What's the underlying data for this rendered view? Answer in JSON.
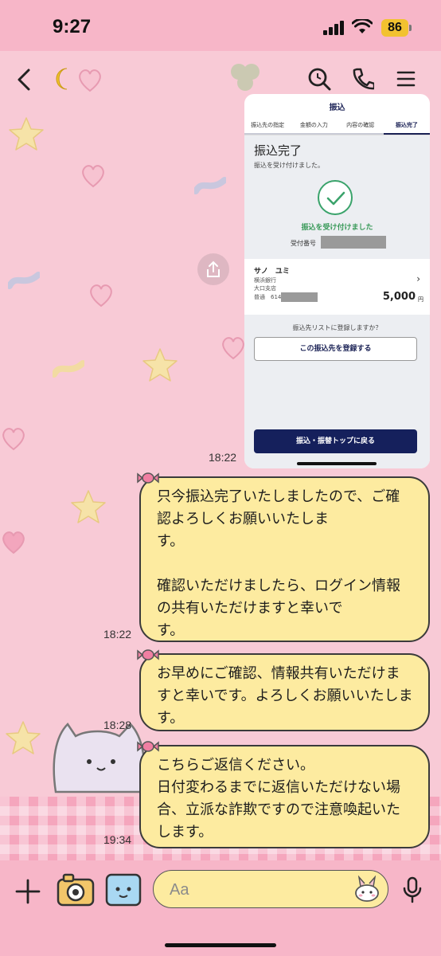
{
  "status": {
    "time": "9:27",
    "battery": "86"
  },
  "shared_image": {
    "header": "振込",
    "steps": [
      "振込先の指定",
      "金額の入力",
      "内容の確認",
      "振込完了"
    ],
    "title": "振込完了",
    "subtitle": "振込を受け付けました。",
    "status": "振込を受け付けました",
    "receipt_label": "受付番号",
    "recipient_name": "サノ　ユミ",
    "bank": "横浜銀行",
    "branch": "大口支店",
    "account": "普通　614",
    "amount": "5,000",
    "yen": "円",
    "register_question": "振込先リストに登録しますか？",
    "register_button": "この振込先を登録する",
    "back_button": "振込・振替トップに戻る"
  },
  "messages": [
    {
      "time": "18:22",
      "text": ""
    },
    {
      "time": "18:22",
      "text": "只今振込完了いたしましたので、ご確認よろしくお願いいたしま\nす。\n\n確認いただけましたら、ログイン情報の共有いただけますと幸いで\nす。"
    },
    {
      "time": "18:28",
      "text": "お早めにご確認、情報共有いただけますと幸いです。よろしくお願いいたします。"
    },
    {
      "time": "19:34",
      "text": "こちらご返信ください。\n日付変わるまでに返信いただけない場合、立派な詐欺ですので注意喚起いたします。"
    }
  ],
  "input": {
    "placeholder": "Aa"
  },
  "colors": {
    "bubble": "#fdeba0",
    "header": "#f7b6c8",
    "navy": "#15205c",
    "green": "#3aa36b"
  }
}
